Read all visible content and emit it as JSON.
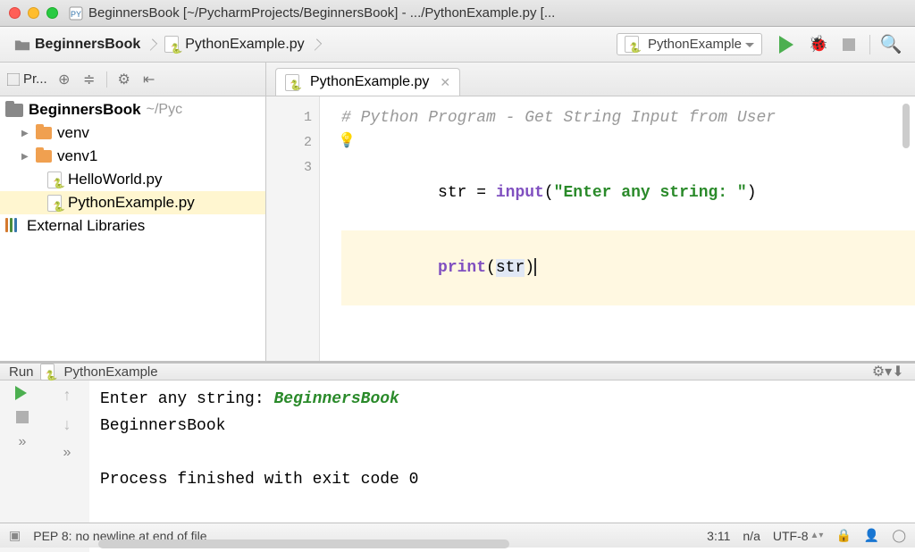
{
  "window": {
    "title": "BeginnersBook [~/PycharmProjects/BeginnersBook] - .../PythonExample.py [..."
  },
  "breadcrumbs": {
    "project": "BeginnersBook",
    "file": "PythonExample.py"
  },
  "runConfig": {
    "selected": "PythonExample"
  },
  "sidebar": {
    "toolTitle": "Pr...",
    "project": "BeginnersBook",
    "projectPath": "~/Pyc",
    "items": [
      {
        "type": "folder",
        "label": "venv"
      },
      {
        "type": "folder",
        "label": "venv1"
      },
      {
        "type": "pyfile",
        "label": "HelloWorld.py"
      },
      {
        "type": "pyfile",
        "label": "PythonExample.py",
        "selected": true
      }
    ],
    "libs": "External Libraries"
  },
  "editor": {
    "tab": "PythonExample.py",
    "gutter": [
      "1",
      "2",
      "3"
    ],
    "code": {
      "commentLine": "# Python Program - Get String Input from User",
      "assignPrefix": "str",
      "assignMid": " = ",
      "builtinInput": "input",
      "paren1": "(",
      "stringArg": "\"Enter any string: \"",
      "paren2": ")",
      "printCall": "print",
      "printArgOpen": "(",
      "printArg": "str",
      "printArgClose": ")"
    }
  },
  "run": {
    "title": "Run",
    "config": "PythonExample",
    "output": {
      "prompt": "Enter any string: ",
      "userInput": "BeginnersBook",
      "echoed": "BeginnersBook",
      "exitLine": "Process finished with exit code 0"
    }
  },
  "status": {
    "message": "PEP 8: no newline at end of file",
    "caret": "3:11",
    "lineSep": "n/a",
    "encoding": "UTF-8"
  }
}
